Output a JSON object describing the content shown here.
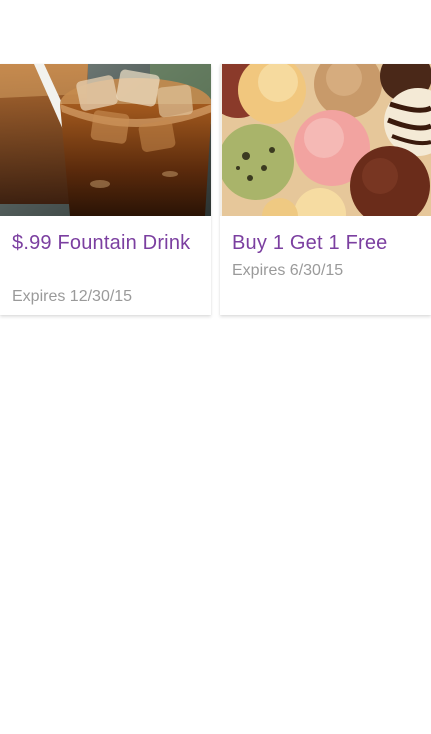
{
  "coupons": [
    {
      "title": "$.99 Fountain Drink",
      "expires": "Expires 12/30/15",
      "image_icon": "soda-cup-image"
    },
    {
      "title": "Buy 1 Get 1 Free",
      "expires": "Expires 6/30/15",
      "image_icon": "ice-cream-scoops-image"
    }
  ],
  "colors": {
    "title": "#7b3fa0",
    "expiry": "#9a9a9a",
    "background": "#ffffff"
  }
}
